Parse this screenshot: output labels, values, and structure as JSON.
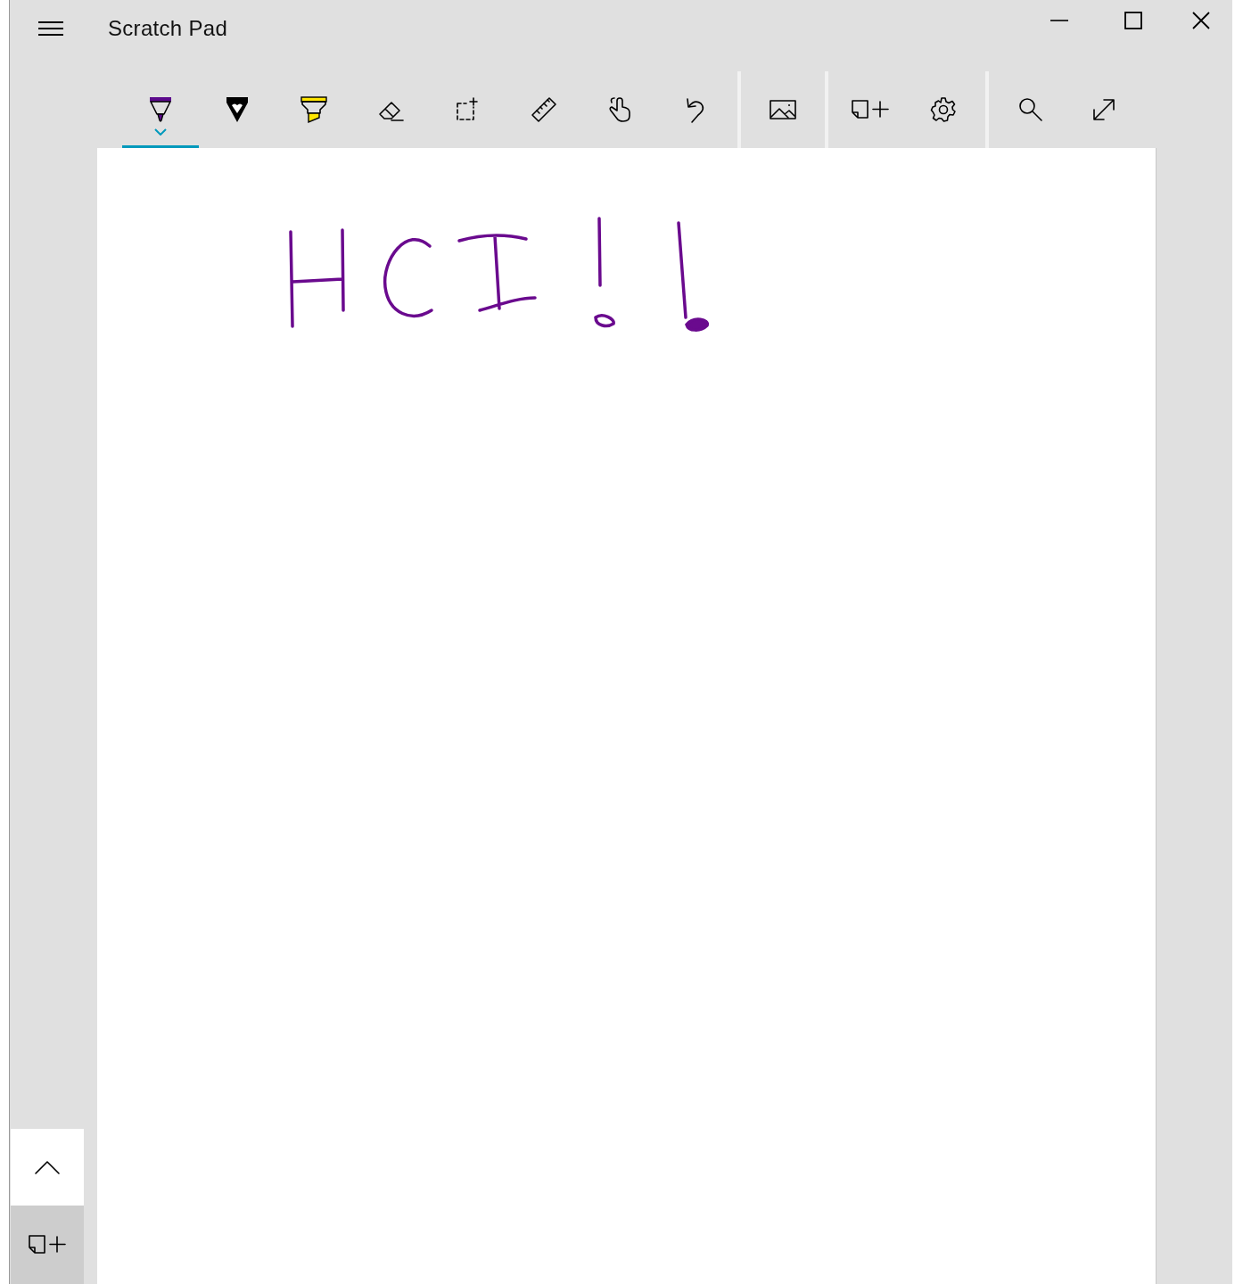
{
  "window": {
    "title": "Scratch Pad"
  },
  "toolbar": [
    {
      "items": [
        {
          "kind": "pen",
          "color": "#5c0a8c",
          "selected": true
        },
        {
          "kind": "pencil",
          "color": "#000000",
          "selected": false
        },
        {
          "kind": "highlighter",
          "color": "#ffe600",
          "selected": false
        },
        {
          "kind": "eraser",
          "selected": false
        },
        {
          "kind": "selection",
          "selected": false
        },
        {
          "kind": "ruler",
          "selected": false
        },
        {
          "kind": "touch",
          "selected": false
        },
        {
          "kind": "undo",
          "selected": false
        }
      ]
    },
    {
      "items": [
        {
          "kind": "image",
          "selected": false
        }
      ]
    },
    {
      "items": [
        {
          "kind": "new-note",
          "selected": false
        },
        {
          "kind": "settings",
          "selected": false
        }
      ]
    },
    {
      "items": [
        {
          "kind": "search",
          "selected": false
        },
        {
          "kind": "resize",
          "selected": false
        }
      ]
    }
  ],
  "side_buttons": [
    {
      "kind": "scroll-up"
    },
    {
      "kind": "new-note"
    }
  ]
}
